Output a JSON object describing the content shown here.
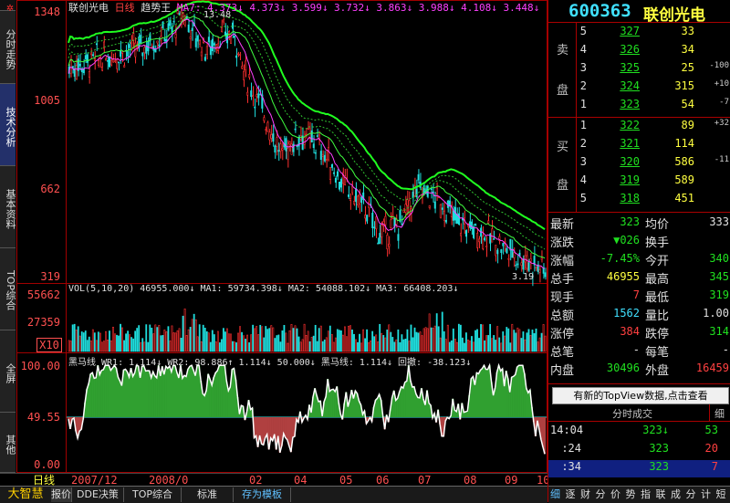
{
  "stock": {
    "code": "600363",
    "name": "联创光电"
  },
  "chart_header": {
    "name": "联创光电",
    "period": "日线",
    "indicator": "趋势王",
    "ma_text": "MA7: 4.373↓ 4.373↓ 3.599↓ 3.732↓ 3.863↓ 3.988↓ 4.108↓ 3.448↓",
    "peak_label": "13.48",
    "low_label": "3.19"
  },
  "price_axis": [
    "1348",
    "1005",
    "662",
    "319"
  ],
  "vol_header": "VOL(5,10,20)  46955.000↓  MA1: 59734.398↓  MA2: 54088.102↓  MA3: 66408.203↓",
  "vol_axis": [
    "55662",
    "27359"
  ],
  "vol_unit": "X10",
  "osc_header": "黑马线  WR1: 1.114↓  WR2: 98.886↑  1.114↓  50.000↓  黑马线: 1.114↓  回撤: -38.123↓",
  "osc_axis": [
    "100.00",
    "49.55",
    "0.00"
  ],
  "date_axis": {
    "period": "日线",
    "labels": [
      "2007/12",
      "2008/0",
      "02",
      "04",
      "05",
      "06",
      "07",
      "08",
      "09",
      "10"
    ]
  },
  "side_tabs": [
    "分时走势",
    "技术分析",
    "基本资料",
    "TOP综合",
    "全屏",
    "其他"
  ],
  "bottom_tabs": [
    "大智慧",
    "报价",
    "DDE决策",
    "TOP综合",
    "标准",
    "存为模板"
  ],
  "order_book": {
    "sell_label": [
      "卖",
      "盘"
    ],
    "buy_label": [
      "买",
      "盘"
    ],
    "sell": [
      {
        "lvl": "5",
        "price": "327",
        "vol": "33",
        "chg": ""
      },
      {
        "lvl": "4",
        "price": "326",
        "vol": "34",
        "chg": ""
      },
      {
        "lvl": "3",
        "price": "325",
        "vol": "25",
        "chg": "-100"
      },
      {
        "lvl": "2",
        "price": "324",
        "vol": "315",
        "chg": "+10"
      },
      {
        "lvl": "1",
        "price": "323",
        "vol": "54",
        "chg": "-7"
      }
    ],
    "buy": [
      {
        "lvl": "1",
        "price": "322",
        "vol": "89",
        "chg": "+32"
      },
      {
        "lvl": "2",
        "price": "321",
        "vol": "114",
        "chg": ""
      },
      {
        "lvl": "3",
        "price": "320",
        "vol": "586",
        "chg": "-11"
      },
      {
        "lvl": "4",
        "price": "319",
        "vol": "589",
        "chg": ""
      },
      {
        "lvl": "5",
        "price": "318",
        "vol": "451",
        "chg": ""
      }
    ]
  },
  "quote": [
    {
      "l1": "最新",
      "v1": "323",
      "c1": "dn",
      "l2": "均价",
      "v2": "333",
      "c2": "wh"
    },
    {
      "l1": "涨跌",
      "v1": "▼026",
      "c1": "dn",
      "l2": "换手",
      "v2": "",
      "c2": "wh"
    },
    {
      "l1": "涨幅",
      "v1": "-7.45%",
      "c1": "dn",
      "l2": "今开",
      "v2": "340",
      "c2": "dn"
    },
    {
      "l1": "总手",
      "v1": "46955",
      "c1": "yl",
      "l2": "最高",
      "v2": "345",
      "c2": "dn"
    },
    {
      "l1": "现手",
      "v1": "7",
      "c1": "up",
      "l2": "最低",
      "v2": "319",
      "c2": "dn"
    },
    {
      "l1": "总额",
      "v1": "1562",
      "c1": "cy",
      "l2": "量比",
      "v2": "1.00",
      "c2": "wh"
    },
    {
      "l1": "涨停",
      "v1": "384",
      "c1": "up",
      "l2": "跌停",
      "v2": "314",
      "c2": "dn"
    },
    {
      "l1": "总笔",
      "v1": "-",
      "c1": "wh",
      "l2": "每笔",
      "v2": "-",
      "c2": "wh"
    },
    {
      "l1": "内盘",
      "v1": "30496",
      "c1": "dn",
      "l2": "外盘",
      "v2": "16459",
      "c2": "up"
    }
  ],
  "topview_button": "有新的TopView数据,点击查看",
  "tick_header": "分时成交",
  "tick_detail": "细",
  "ticks": [
    {
      "time": "14:04",
      "price": "323↓",
      "vol": "53",
      "vc": "dn"
    },
    {
      "time": ":24",
      "price": "323",
      "vol": "20",
      "vc": "up"
    },
    {
      "time": ":34",
      "price": "323",
      "vol": "7",
      "vc": "up"
    }
  ],
  "right_tabs": [
    "细",
    "逐",
    "财",
    "分",
    "价",
    "势",
    "指",
    "联",
    "成",
    "分",
    "计",
    "短"
  ]
}
